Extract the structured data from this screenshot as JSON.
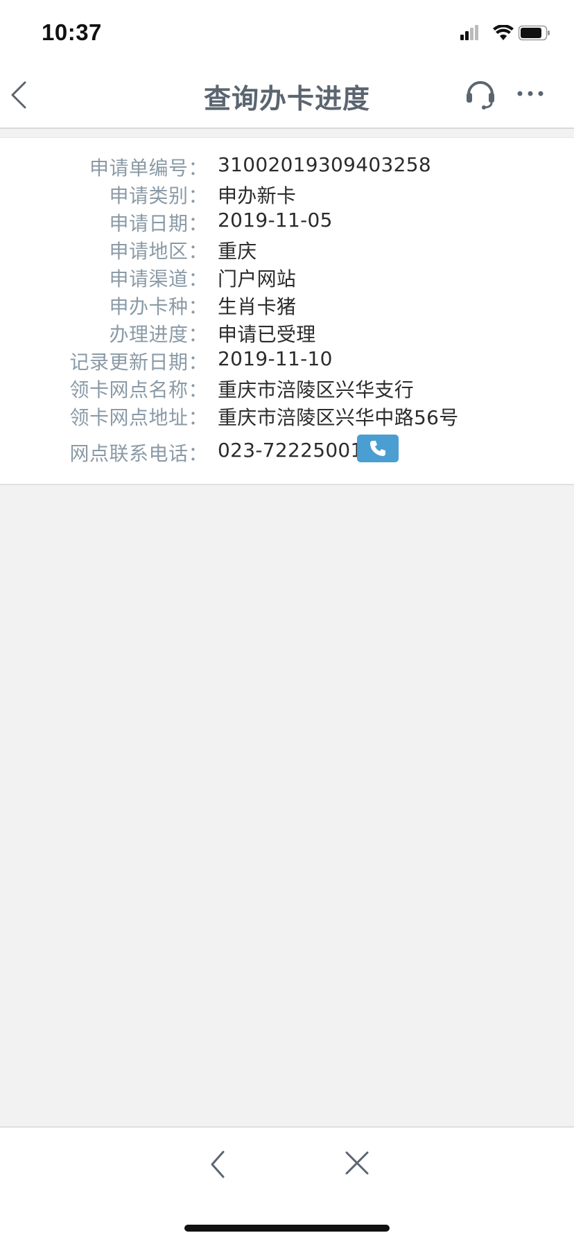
{
  "status_bar": {
    "time": "10:37",
    "icons": [
      "signal-icon",
      "wifi-icon",
      "battery-icon"
    ]
  },
  "nav": {
    "title": "查询办卡进度",
    "icons": [
      "back-icon",
      "headset-icon",
      "more-icon"
    ]
  },
  "info": {
    "rows": [
      {
        "label": "申请单编号：",
        "value": "31002019309403258"
      },
      {
        "label": "申请类别：",
        "value": "申办新卡"
      },
      {
        "label": "申请日期：",
        "value": "2019-11-05"
      },
      {
        "label": "申请地区：",
        "value": "重庆"
      },
      {
        "label": "申请渠道：",
        "value": "门户网站"
      },
      {
        "label": "申办卡种：",
        "value": "生肖卡猪"
      },
      {
        "label": "办理进度：",
        "value": "申请已受理"
      },
      {
        "label": "记录更新日期：",
        "value": "2019-11-10"
      },
      {
        "label": "领卡网点名称：",
        "value": "重庆市涪陵区兴华支行"
      },
      {
        "label": "领卡网点地址：",
        "value": "重庆市涪陵区兴华中路56号"
      },
      {
        "label": "网点联系电话：",
        "value": "023-72225001"
      }
    ]
  },
  "bottom_bar": {
    "icons": [
      "back-icon",
      "close-icon"
    ]
  },
  "colors": {
    "label": "#8a9aa6",
    "value": "#2b2b2b",
    "title": "#5b6570",
    "phone_button": "#4a9ed1",
    "background": "#f2f2f2"
  }
}
